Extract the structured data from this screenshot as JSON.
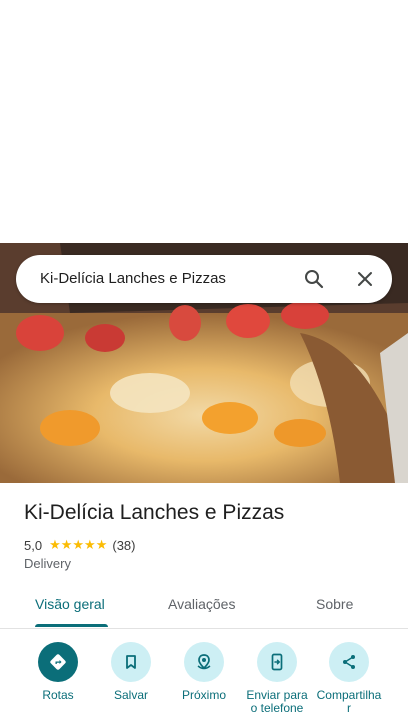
{
  "search": {
    "query": "Ki-Delícia Lanches e Pizzas",
    "search_icon": "search-icon",
    "close_icon": "close-icon"
  },
  "place": {
    "name": "Ki-Delícia Lanches e Pizzas",
    "rating": "5,0",
    "stars": "★★★★★",
    "review_count": "(38)",
    "category": "Delivery"
  },
  "tabs": [
    {
      "label": "Visão geral",
      "active": true
    },
    {
      "label": "Avaliações",
      "active": false
    },
    {
      "label": "Sobre",
      "active": false
    }
  ],
  "actions": [
    {
      "label": "Rotas",
      "icon": "directions-icon"
    },
    {
      "label": "Salvar",
      "icon": "bookmark-icon"
    },
    {
      "label": "Próximo",
      "icon": "nearby-icon"
    },
    {
      "label": "Enviar para o telefone",
      "icon": "send-to-phone-icon"
    },
    {
      "label": "Compartilhar",
      "icon": "share-icon"
    }
  ],
  "colors": {
    "accent": "#0b6e79",
    "action_bg": "#cdeff4",
    "star": "#fbbc04"
  }
}
